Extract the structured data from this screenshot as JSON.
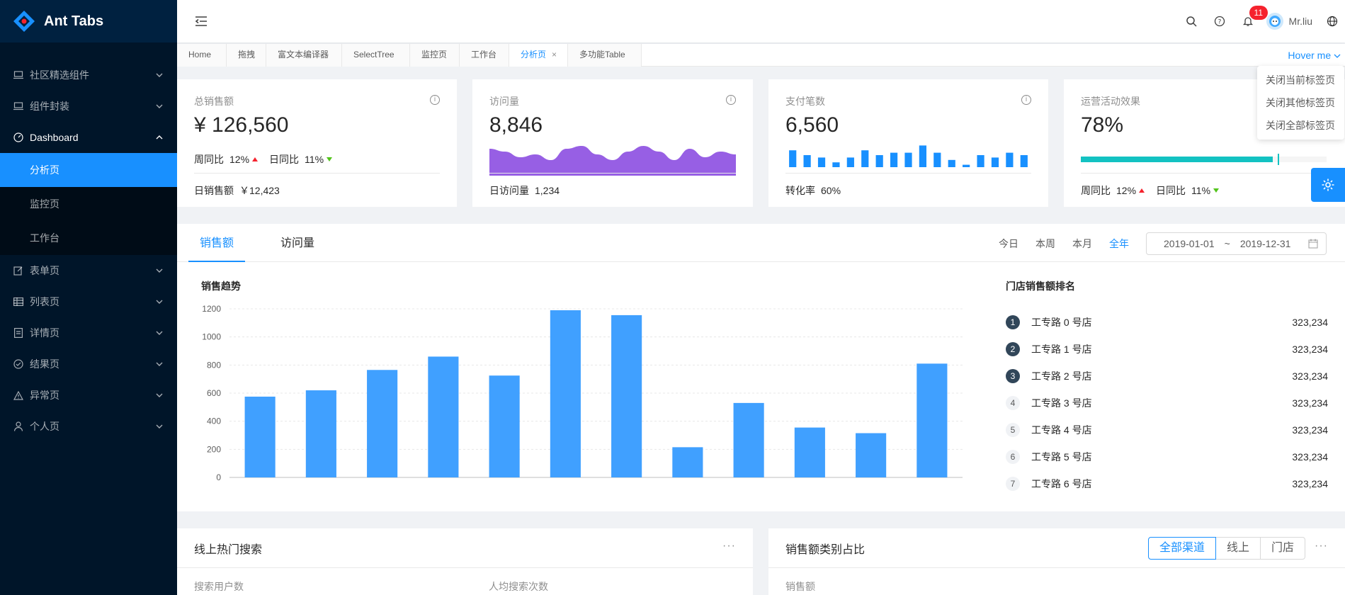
{
  "app": {
    "title": "Ant Tabs"
  },
  "sidebar": {
    "items": [
      {
        "label": "社区精选组件",
        "icon": "laptop-icon"
      },
      {
        "label": "组件封装",
        "icon": "laptop-icon"
      },
      {
        "label": "Dashboard",
        "icon": "dashboard-icon"
      },
      {
        "label": "表单页",
        "icon": "form-icon"
      },
      {
        "label": "列表页",
        "icon": "table-icon"
      },
      {
        "label": "详情页",
        "icon": "profile-icon"
      },
      {
        "label": "结果页",
        "icon": "check-circle-icon"
      },
      {
        "label": "异常页",
        "icon": "warning-icon"
      },
      {
        "label": "个人页",
        "icon": "user-icon"
      }
    ],
    "dashboard_children": [
      "分析页",
      "监控页",
      "工作台"
    ]
  },
  "header": {
    "notification_count": "11",
    "username": "Mr.liu"
  },
  "tabs": {
    "items": [
      "Home",
      "拖拽",
      "富文本编译器",
      "SelectTree",
      "监控页",
      "工作台",
      "分析页",
      "多功能Table"
    ],
    "active": "分析页",
    "hover_label": "Hover me",
    "menu": [
      "关闭当前标签页",
      "关闭其他标签页",
      "关闭全部标签页"
    ]
  },
  "cards": {
    "sales": {
      "title": "总销售额",
      "total": "¥ 126,560",
      "wow_label": "周同比",
      "wow": "12%",
      "dod_label": "日同比",
      "dod": "11%",
      "footer_label": "日销售额",
      "footer_value": "￥12,423"
    },
    "visits": {
      "title": "访问量",
      "total": "8,846",
      "footer_label": "日访问量",
      "footer_value": "1,234"
    },
    "payments": {
      "title": "支付笔数",
      "total": "6,560",
      "footer_label": "转化率",
      "footer_value": "60%"
    },
    "operations": {
      "title": "运营活动效果",
      "total": "78%",
      "progress": 0.78,
      "wow_label": "周同比",
      "wow": "12%",
      "dod_label": "日同比",
      "dod": "11%"
    }
  },
  "sales_panel": {
    "tabs": [
      "销售额",
      "访问量"
    ],
    "range_links": [
      "今日",
      "本周",
      "本月",
      "全年"
    ],
    "active_range": "全年",
    "date_start": "2019-01-01",
    "date_sep": "~",
    "date_end": "2019-12-31",
    "chart_title": "销售趋势",
    "ranking_title": "门店销售额排名",
    "ranking": [
      {
        "rank": "1",
        "name": "工专路 0 号店",
        "value": "323,234"
      },
      {
        "rank": "2",
        "name": "工专路 1 号店",
        "value": "323,234"
      },
      {
        "rank": "3",
        "name": "工专路 2 号店",
        "value": "323,234"
      },
      {
        "rank": "4",
        "name": "工专路 3 号店",
        "value": "323,234"
      },
      {
        "rank": "5",
        "name": "工专路 4 号店",
        "value": "323,234"
      },
      {
        "rank": "6",
        "name": "工专路 5 号店",
        "value": "323,234"
      },
      {
        "rank": "7",
        "name": "工专路 6 号店",
        "value": "323,234"
      }
    ]
  },
  "chart_data": [
    {
      "type": "bar",
      "title": "销售趋势",
      "values": [
        575,
        620,
        765,
        860,
        725,
        1190,
        1155,
        215,
        530,
        355,
        315,
        810
      ],
      "ylim": [
        0,
        1200
      ],
      "yticks": [
        0,
        200,
        400,
        600,
        800,
        1000,
        1200
      ],
      "grid": true,
      "color": "#40a0ff"
    },
    {
      "type": "area",
      "values": [
        6,
        5,
        3,
        4,
        2,
        6,
        7,
        4,
        2,
        5,
        7,
        5,
        2,
        6,
        3,
        5,
        4
      ],
      "color": "#975fe4"
    },
    {
      "type": "bar",
      "values": [
        7,
        5,
        4,
        2,
        4,
        7,
        5,
        6,
        6,
        9,
        6,
        3,
        1,
        5,
        4,
        6,
        5
      ],
      "color": "#1890ff"
    }
  ],
  "bottom": {
    "search_title": "线上热门搜索",
    "search_users_label": "搜索用户数",
    "search_per_label": "人均搜索次数",
    "category_title": "销售额类别占比",
    "channels": [
      "全部渠道",
      "线上",
      "门店"
    ],
    "active_channel": "全部渠道",
    "category_peek": "销售额"
  },
  "colors": {
    "primary": "#1890ff",
    "sider": "#001529",
    "progress": "#13c2c2"
  }
}
